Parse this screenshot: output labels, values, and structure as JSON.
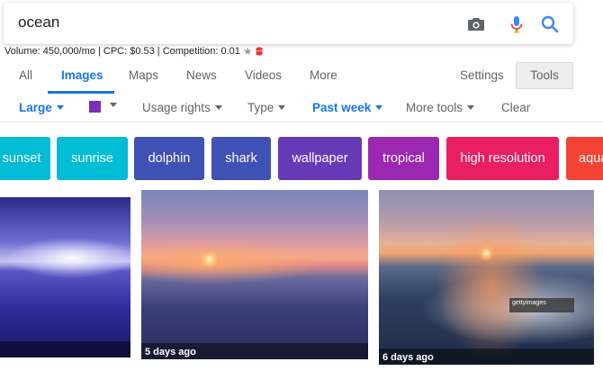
{
  "search": {
    "query": "ocean",
    "icons": [
      "camera-icon",
      "microphone-icon",
      "search-icon"
    ]
  },
  "seo": {
    "text": "Volume: 450,000/mo | CPC: $0.53 | Competition: 0.01"
  },
  "tabs": {
    "items": [
      {
        "label": "All"
      },
      {
        "label": "Images"
      },
      {
        "label": "Maps"
      },
      {
        "label": "News"
      },
      {
        "label": "Videos"
      },
      {
        "label": "More"
      }
    ],
    "active": "Images",
    "settings": "Settings",
    "tools": "Tools"
  },
  "filters": {
    "size": "Large",
    "color_value": "#7b2fb8",
    "usage": "Usage rights",
    "type": "Type",
    "time": "Past week",
    "more": "More tools",
    "clear": "Clear"
  },
  "chips": [
    {
      "label": "sunset",
      "color": "#00bcd4"
    },
    {
      "label": "sunrise",
      "color": "#00bcd4"
    },
    {
      "label": "dolphin",
      "color": "#3f51b5"
    },
    {
      "label": "shark",
      "color": "#3f51b5"
    },
    {
      "label": "wallpaper",
      "color": "#673ab7"
    },
    {
      "label": "tropical",
      "color": "#9c27b0"
    },
    {
      "label": "high resolution",
      "color": "#e91e63"
    },
    {
      "label": "aqua",
      "color": "#f44336"
    }
  ],
  "results": [
    {
      "age": ""
    },
    {
      "age": "5 days ago"
    },
    {
      "age": "6 days ago",
      "watermark": "gettyimages"
    }
  ],
  "colors": {
    "accent": "#1a73e8",
    "muted": "#5f6368"
  }
}
